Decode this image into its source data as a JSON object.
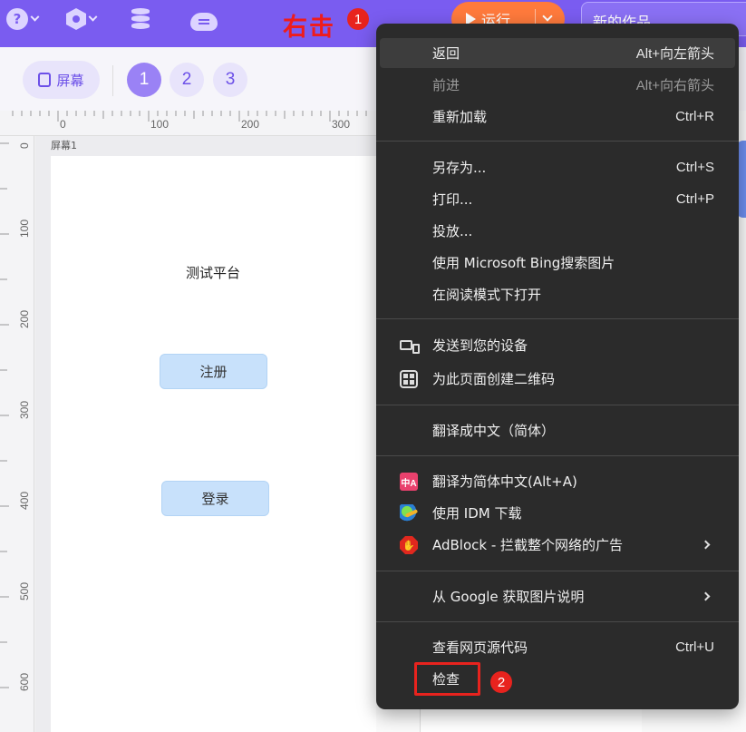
{
  "topbar": {
    "icons": [
      "help-icon",
      "plugin-icon",
      "database-icon",
      "cloud-icon"
    ],
    "help_glyph": "?",
    "run_label": "运行",
    "project_title": "新的作品"
  },
  "annotations": {
    "right_click_text": "右击",
    "step1": "1",
    "step2": "2",
    "color": "#e8231e"
  },
  "subbar": {
    "screen_label": "屏幕",
    "pages": [
      "1",
      "2",
      "3"
    ],
    "active_page": "1"
  },
  "ruler": {
    "h_labels": [
      "0",
      "100",
      "200",
      "300"
    ],
    "v_labels": [
      "0",
      "100",
      "200",
      "300",
      "400",
      "500",
      "600"
    ]
  },
  "canvas": {
    "screen_name": "屏幕1",
    "app_title": "测试平台",
    "register_label": "注册",
    "login_label": "登录"
  },
  "context_menu": {
    "items": [
      {
        "label": "返回",
        "shortcut": "Alt+向左箭头"
      },
      {
        "label": "前进",
        "shortcut": "Alt+向右箭头"
      },
      {
        "label": "重新加载",
        "shortcut": "Ctrl+R"
      },
      {
        "label": "另存为...",
        "shortcut": "Ctrl+S"
      },
      {
        "label": "打印...",
        "shortcut": "Ctrl+P"
      },
      {
        "label": "投放...",
        "shortcut": ""
      },
      {
        "label": "使用 Microsoft Bing搜索图片",
        "shortcut": ""
      },
      {
        "label": "在阅读模式下打开",
        "shortcut": ""
      },
      {
        "label": "发送到您的设备",
        "shortcut": ""
      },
      {
        "label": "为此页面创建二维码",
        "shortcut": ""
      },
      {
        "label": "翻译成中文（简体）",
        "shortcut": ""
      },
      {
        "label": "翻译为简体中文(Alt+A)",
        "shortcut": ""
      },
      {
        "label": "使用 IDM 下载",
        "shortcut": ""
      },
      {
        "label": "AdBlock - 拦截整个网络的广告",
        "shortcut": ""
      },
      {
        "label": "从 Google 获取图片说明",
        "shortcut": ""
      },
      {
        "label": "查看网页源代码",
        "shortcut": "Ctrl+U"
      },
      {
        "label": "检查",
        "shortcut": ""
      }
    ],
    "translate_icon_text": "中A",
    "colors": {
      "menu_bg": "#2b2b2b",
      "hover_bg": "#3d3d3d",
      "accent": "#7a5cf0",
      "run": "#ff7a3c"
    }
  }
}
